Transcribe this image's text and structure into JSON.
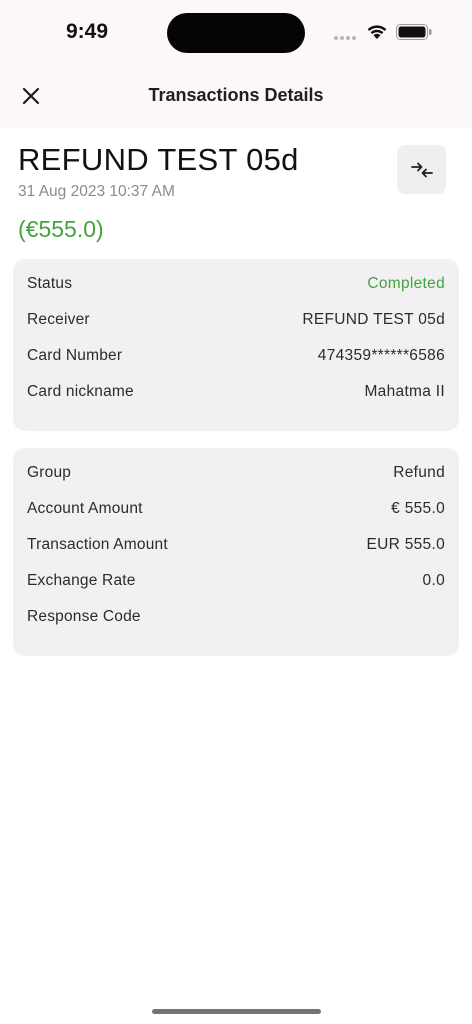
{
  "status_bar": {
    "time": "9:49"
  },
  "nav": {
    "title": "Transactions Details",
    "close_icon": "close-icon"
  },
  "transaction": {
    "title": "REFUND TEST 05d",
    "date": "31 Aug 2023 10:37 AM",
    "amount": "(€555.0)",
    "swap_icon": "swap-arrows-icon"
  },
  "details_card": {
    "rows": [
      {
        "label": "Status",
        "value": "Completed"
      },
      {
        "label": "Receiver",
        "value": "REFUND TEST 05d"
      },
      {
        "label": "Card Number",
        "value": "474359******6586"
      },
      {
        "label": "Card nickname",
        "value": "Mahatma II"
      }
    ]
  },
  "amounts_card": {
    "rows": [
      {
        "label": "Group",
        "value": "Refund"
      },
      {
        "label": "Account Amount",
        "value": "€ 555.0"
      },
      {
        "label": "Transaction Amount",
        "value": "EUR 555.0"
      },
      {
        "label": "Exchange Rate",
        "value": "0.0"
      },
      {
        "label": "Response Code",
        "value": ""
      }
    ]
  },
  "colors": {
    "accent_green": "#43a33c",
    "header_bg": "#fcf7fb",
    "card_bg": "#f3f0f4"
  }
}
